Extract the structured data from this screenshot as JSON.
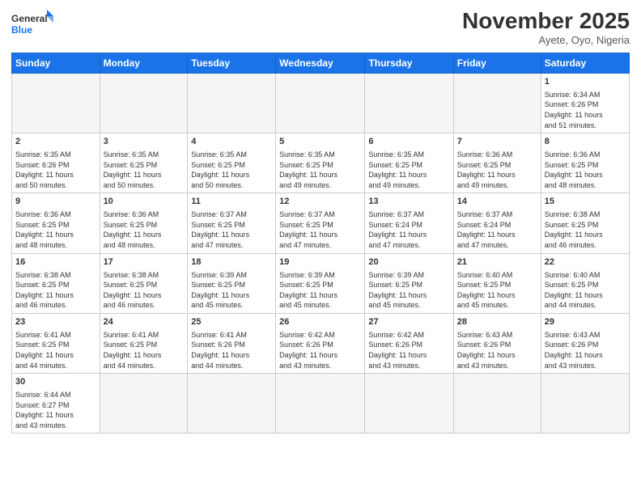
{
  "logo": {
    "general": "General",
    "blue": "Blue"
  },
  "header": {
    "title": "November 2025",
    "location": "Ayete, Oyo, Nigeria"
  },
  "weekdays": [
    "Sunday",
    "Monday",
    "Tuesday",
    "Wednesday",
    "Thursday",
    "Friday",
    "Saturday"
  ],
  "weeks": [
    [
      {
        "day": "",
        "info": ""
      },
      {
        "day": "",
        "info": ""
      },
      {
        "day": "",
        "info": ""
      },
      {
        "day": "",
        "info": ""
      },
      {
        "day": "",
        "info": ""
      },
      {
        "day": "",
        "info": ""
      },
      {
        "day": "1",
        "info": "Sunrise: 6:34 AM\nSunset: 6:26 PM\nDaylight: 11 hours\nand 51 minutes."
      }
    ],
    [
      {
        "day": "2",
        "info": "Sunrise: 6:35 AM\nSunset: 6:26 PM\nDaylight: 11 hours\nand 50 minutes."
      },
      {
        "day": "3",
        "info": "Sunrise: 6:35 AM\nSunset: 6:25 PM\nDaylight: 11 hours\nand 50 minutes."
      },
      {
        "day": "4",
        "info": "Sunrise: 6:35 AM\nSunset: 6:25 PM\nDaylight: 11 hours\nand 50 minutes."
      },
      {
        "day": "5",
        "info": "Sunrise: 6:35 AM\nSunset: 6:25 PM\nDaylight: 11 hours\nand 49 minutes."
      },
      {
        "day": "6",
        "info": "Sunrise: 6:35 AM\nSunset: 6:25 PM\nDaylight: 11 hours\nand 49 minutes."
      },
      {
        "day": "7",
        "info": "Sunrise: 6:36 AM\nSunset: 6:25 PM\nDaylight: 11 hours\nand 49 minutes."
      },
      {
        "day": "8",
        "info": "Sunrise: 6:36 AM\nSunset: 6:25 PM\nDaylight: 11 hours\nand 48 minutes."
      }
    ],
    [
      {
        "day": "9",
        "info": "Sunrise: 6:36 AM\nSunset: 6:25 PM\nDaylight: 11 hours\nand 48 minutes."
      },
      {
        "day": "10",
        "info": "Sunrise: 6:36 AM\nSunset: 6:25 PM\nDaylight: 11 hours\nand 48 minutes."
      },
      {
        "day": "11",
        "info": "Sunrise: 6:37 AM\nSunset: 6:25 PM\nDaylight: 11 hours\nand 47 minutes."
      },
      {
        "day": "12",
        "info": "Sunrise: 6:37 AM\nSunset: 6:25 PM\nDaylight: 11 hours\nand 47 minutes."
      },
      {
        "day": "13",
        "info": "Sunrise: 6:37 AM\nSunset: 6:24 PM\nDaylight: 11 hours\nand 47 minutes."
      },
      {
        "day": "14",
        "info": "Sunrise: 6:37 AM\nSunset: 6:24 PM\nDaylight: 11 hours\nand 47 minutes."
      },
      {
        "day": "15",
        "info": "Sunrise: 6:38 AM\nSunset: 6:25 PM\nDaylight: 11 hours\nand 46 minutes."
      }
    ],
    [
      {
        "day": "16",
        "info": "Sunrise: 6:38 AM\nSunset: 6:25 PM\nDaylight: 11 hours\nand 46 minutes."
      },
      {
        "day": "17",
        "info": "Sunrise: 6:38 AM\nSunset: 6:25 PM\nDaylight: 11 hours\nand 46 minutes."
      },
      {
        "day": "18",
        "info": "Sunrise: 6:39 AM\nSunset: 6:25 PM\nDaylight: 11 hours\nand 45 minutes."
      },
      {
        "day": "19",
        "info": "Sunrise: 6:39 AM\nSunset: 6:25 PM\nDaylight: 11 hours\nand 45 minutes."
      },
      {
        "day": "20",
        "info": "Sunrise: 6:39 AM\nSunset: 6:25 PM\nDaylight: 11 hours\nand 45 minutes."
      },
      {
        "day": "21",
        "info": "Sunrise: 6:40 AM\nSunset: 6:25 PM\nDaylight: 11 hours\nand 45 minutes."
      },
      {
        "day": "22",
        "info": "Sunrise: 6:40 AM\nSunset: 6:25 PM\nDaylight: 11 hours\nand 44 minutes."
      }
    ],
    [
      {
        "day": "23",
        "info": "Sunrise: 6:41 AM\nSunset: 6:25 PM\nDaylight: 11 hours\nand 44 minutes."
      },
      {
        "day": "24",
        "info": "Sunrise: 6:41 AM\nSunset: 6:25 PM\nDaylight: 11 hours\nand 44 minutes."
      },
      {
        "day": "25",
        "info": "Sunrise: 6:41 AM\nSunset: 6:26 PM\nDaylight: 11 hours\nand 44 minutes."
      },
      {
        "day": "26",
        "info": "Sunrise: 6:42 AM\nSunset: 6:26 PM\nDaylight: 11 hours\nand 43 minutes."
      },
      {
        "day": "27",
        "info": "Sunrise: 6:42 AM\nSunset: 6:26 PM\nDaylight: 11 hours\nand 43 minutes."
      },
      {
        "day": "28",
        "info": "Sunrise: 6:43 AM\nSunset: 6:26 PM\nDaylight: 11 hours\nand 43 minutes."
      },
      {
        "day": "29",
        "info": "Sunrise: 6:43 AM\nSunset: 6:26 PM\nDaylight: 11 hours\nand 43 minutes."
      }
    ],
    [
      {
        "day": "30",
        "info": "Sunrise: 6:44 AM\nSunset: 6:27 PM\nDaylight: 11 hours\nand 43 minutes."
      },
      {
        "day": "",
        "info": ""
      },
      {
        "day": "",
        "info": ""
      },
      {
        "day": "",
        "info": ""
      },
      {
        "day": "",
        "info": ""
      },
      {
        "day": "",
        "info": ""
      },
      {
        "day": "",
        "info": ""
      }
    ]
  ]
}
